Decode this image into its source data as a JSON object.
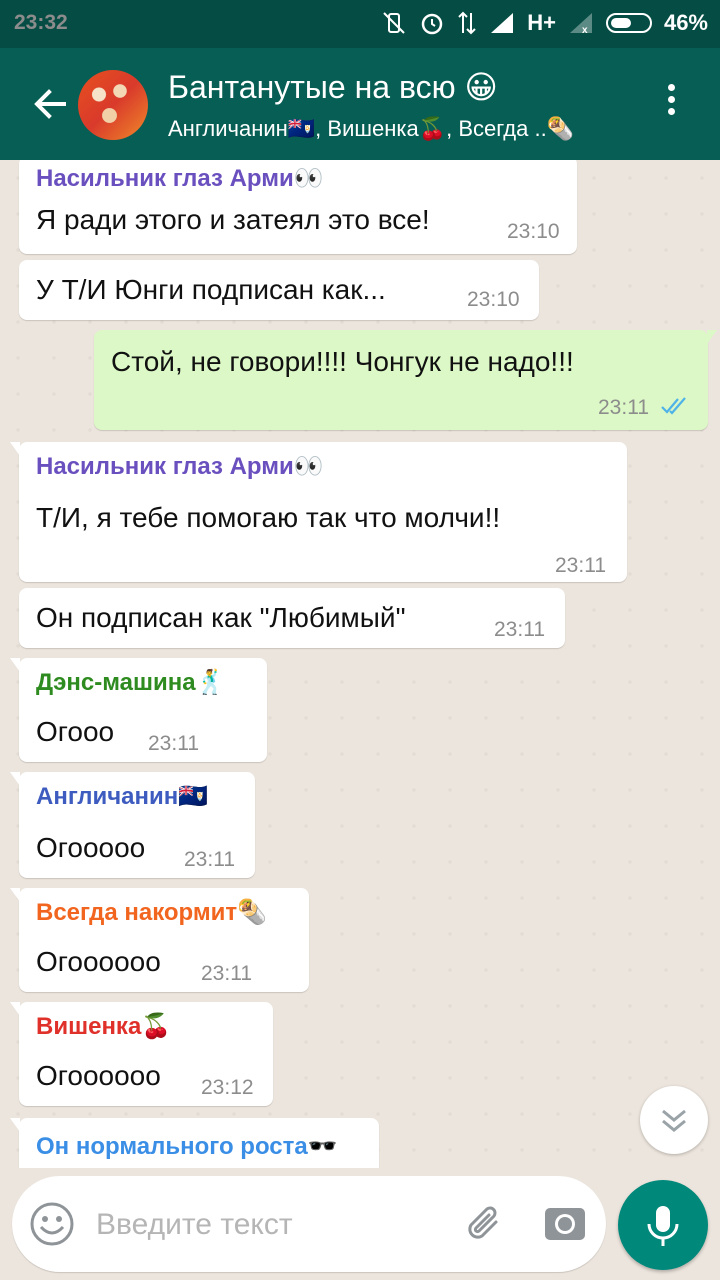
{
  "status_bar": {
    "time": "23:32",
    "network": "H+",
    "battery": "46%",
    "battery_level": 0.46
  },
  "header": {
    "title": "Бантанутые на всю 😀",
    "subtitle": "Англичанин🇦🇮, Вишенка🍒, Всегда ..🌯"
  },
  "colors": {
    "header": "#075E54",
    "statusbar": "#054D44",
    "outgoing": "#DCF8C6",
    "incoming": "#FFFFFF",
    "sender_purple": "#6A4FBF",
    "sender_green": "#2E8B1F",
    "sender_blue": "#3E5CBF",
    "sender_orange": "#F2651F",
    "sender_red": "#E0302A",
    "sender_lightblue": "#3A8EE6"
  },
  "messages": [
    {
      "sender": "Насильник глаз Арми👀",
      "text": "Я ради этого и затеял это все!",
      "time": "23:10"
    },
    {
      "text": "У Т/И Юнги подписан как...",
      "time": "23:10"
    },
    {
      "text": "Стой, не говори!!!! Чонгук не надо!!!",
      "time": "23:11",
      "status": "read"
    },
    {
      "sender": "Насильник глаз Арми👀",
      "text": "Т/И, я тебе помогаю так что молчи!!",
      "time": "23:11"
    },
    {
      "text": "Он подписан как \"Любимый\"",
      "time": "23:11"
    },
    {
      "sender": "Дэнс-машина🕺",
      "text": "Огооо",
      "time": "23:11"
    },
    {
      "sender": "Англичанин🇦🇮",
      "text": "Огооооо",
      "time": "23:11"
    },
    {
      "sender": "Всегда накормит🌯",
      "text": "Огоооооо",
      "time": "23:11"
    },
    {
      "sender": "Вишенка🍒",
      "text": "Огоооооо",
      "time": "23:12"
    },
    {
      "sender": "Он нормального роста🕶️"
    }
  ],
  "footer": {
    "placeholder": "Введите текст"
  },
  "icons": {
    "back": "arrow-left-icon",
    "menu": "more-vert-icon",
    "emoji": "emoji-icon",
    "attach": "paperclip-icon",
    "camera": "camera-icon",
    "mic": "microphone-icon",
    "scroll": "chevron-down-double-icon",
    "read": "double-check-icon"
  }
}
